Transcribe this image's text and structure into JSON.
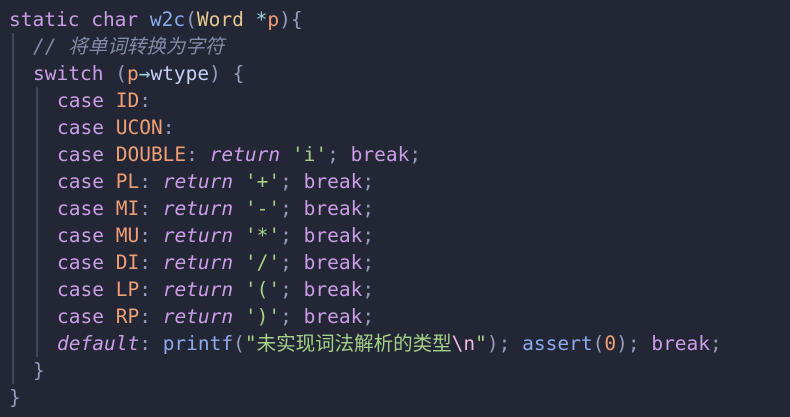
{
  "code": {
    "l1": {
      "static": "static",
      "char": "char",
      "fname": "w2c",
      "lparen": "(",
      "type": "Word",
      "star": "*",
      "param": "p",
      "rparen": ")",
      "brace": "{"
    },
    "l2": {
      "comment": "// 将单词转换为字符"
    },
    "l3": {
      "switch": "switch",
      "lparen": "(",
      "p": "p",
      "arrow": "→",
      "field": "wtype",
      "rparen": ")",
      "brace": "{"
    },
    "l4": {
      "case": "case",
      "label": "ID",
      "colon": ":"
    },
    "l5": {
      "case": "case",
      "label": "UCON",
      "colon": ":"
    },
    "l6": {
      "case": "case",
      "label": "DOUBLE",
      "colon": ":",
      "ret": "return",
      "char": "'i'",
      "semi": ";",
      "brk": "break",
      "semi2": ";"
    },
    "l7": {
      "case": "case",
      "label": "PL",
      "colon": ":",
      "ret": "return",
      "char": "'+'",
      "semi": ";",
      "brk": "break",
      "semi2": ";"
    },
    "l8": {
      "case": "case",
      "label": "MI",
      "colon": ":",
      "ret": "return",
      "char": "'-'",
      "semi": ";",
      "brk": "break",
      "semi2": ";"
    },
    "l9": {
      "case": "case",
      "label": "MU",
      "colon": ":",
      "ret": "return",
      "char": "'*'",
      "semi": ";",
      "brk": "break",
      "semi2": ";"
    },
    "l10": {
      "case": "case",
      "label": "DI",
      "colon": ":",
      "ret": "return",
      "char": "'/'",
      "semi": ";",
      "brk": "break",
      "semi2": ";"
    },
    "l11": {
      "case": "case",
      "label": "LP",
      "colon": ":",
      "ret": "return",
      "char": "'('",
      "semi": ";",
      "brk": "break",
      "semi2": ";"
    },
    "l12": {
      "case": "case",
      "label": "RP",
      "colon": ":",
      "ret": "return",
      "char": "')'",
      "semi": ";",
      "brk": "break",
      "semi2": ";"
    },
    "l13": {
      "def": "default",
      "colon": ":",
      "fn": "printf",
      "lparen": "(",
      "str1": "\"未实现词法解析的类型",
      "esc": "\\n",
      "str2": "\"",
      "rparen": ")",
      "semi": ";",
      "fn2": "assert",
      "lparen2": "(",
      "num": "0",
      "rparen2": ")",
      "semi2": ";",
      "brk": "break",
      "semi3": ";"
    },
    "l14": {
      "brace": "}"
    },
    "l15": {
      "brace": "}"
    }
  },
  "colors": {
    "background": "#232634",
    "keyword": "#ca9ee6",
    "function": "#8caaee",
    "type": "#e5c890",
    "string": "#a6d189",
    "constant": "#ef9f76",
    "comment": "#838ba7",
    "operator": "#99d1db"
  }
}
